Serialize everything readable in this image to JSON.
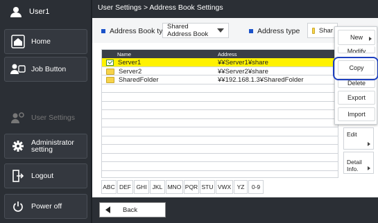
{
  "sidebar": {
    "user": "User1",
    "items": [
      {
        "label": "Home",
        "icon": "home-icon"
      },
      {
        "label": "Job Button",
        "icon": "job-button-icon"
      },
      {
        "label": "User Settings",
        "icon": "user-settings-icon",
        "disabled": true
      },
      {
        "label": "Administrator setting",
        "icon": "gear-icon"
      },
      {
        "label": "Logout",
        "icon": "logout-icon"
      },
      {
        "label": "Power off",
        "icon": "power-icon"
      }
    ]
  },
  "header": {
    "breadcrumb": "User Settings > Address Book Settings"
  },
  "filters": {
    "book_type_label": "Address Book type",
    "book_type_value": "Shared Address Book",
    "address_type_label": "Address type",
    "address_type_value": "Shar"
  },
  "table": {
    "columns": [
      "Name",
      "Address"
    ],
    "rows": [
      {
        "name": "Server1",
        "address": "¥¥Server1¥share",
        "selected": true
      },
      {
        "name": "Server2",
        "address": "¥¥Server2¥share",
        "selected": false
      },
      {
        "name": "SharedFolder",
        "address": "¥¥192.168.1.3¥SharedFolder",
        "selected": false
      }
    ]
  },
  "alpha_tabs": [
    "ABC",
    "DEF",
    "GHI",
    "JKL",
    "MNO",
    "PQR",
    "STU",
    "VWX",
    "YZ",
    "0-9"
  ],
  "menu": {
    "new": "New",
    "modify": "Modify",
    "copy": "Copy",
    "delete": "Delete",
    "export": "Export",
    "import": "Import"
  },
  "side_buttons": {
    "edit": "Edit",
    "detail": "Detail Info."
  },
  "footer": {
    "back": "Back"
  },
  "colors": {
    "accent": "#1b52c9",
    "selected_row": "#fff200",
    "sidebar": "#2b2f35"
  }
}
